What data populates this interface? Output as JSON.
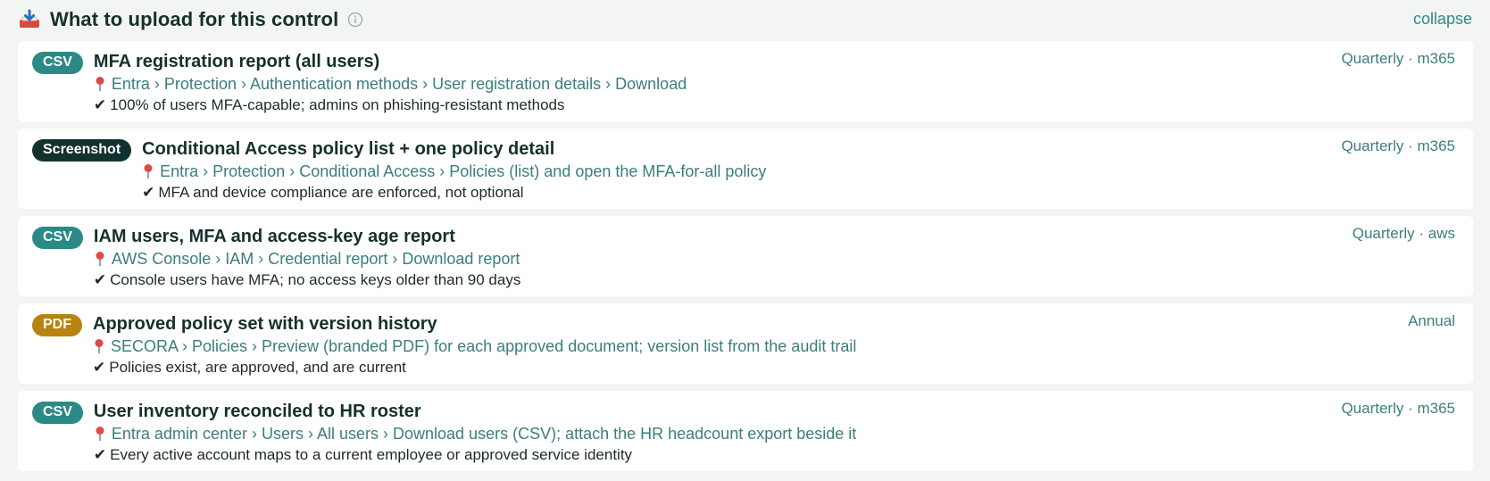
{
  "header": {
    "title": "What to upload for this control",
    "collapse_label": "collapse"
  },
  "items": [
    {
      "badge": "CSV",
      "badge_type": "csv",
      "title": "MFA registration report (all users)",
      "path": "Entra › Protection › Authentication methods › User registration details › Download",
      "check": "100% of users MFA-capable; admins on phishing-resistant methods",
      "meta": "Quarterly · m365"
    },
    {
      "badge": "Screenshot",
      "badge_type": "screenshot",
      "title": "Conditional Access policy list + one policy detail",
      "path": "Entra › Protection › Conditional Access › Policies (list) and open the MFA-for-all policy",
      "check": "MFA and device compliance are enforced, not optional",
      "meta": "Quarterly · m365"
    },
    {
      "badge": "CSV",
      "badge_type": "csv",
      "title": "IAM users, MFA and access-key age report",
      "path": "AWS Console › IAM › Credential report › Download report",
      "check": "Console users have MFA; no access keys older than 90 days",
      "meta": "Quarterly · aws"
    },
    {
      "badge": "PDF",
      "badge_type": "pdf",
      "title": "Approved policy set with version history",
      "path": "SECORA › Policies › Preview (branded PDF) for each approved document; version list from the audit trail",
      "check": "Policies exist, are approved, and are current",
      "meta": "Annual"
    },
    {
      "badge": "CSV",
      "badge_type": "csv",
      "title": "User inventory reconciled to HR roster",
      "path": "Entra admin center › Users › All users › Download users (CSV); attach the HR headcount export beside it",
      "check": "Every active account maps to a current employee or approved service identity",
      "meta": "Quarterly · m365"
    }
  ],
  "colors": {
    "csv_badge": "#2c8a86",
    "screenshot_badge": "#13322f",
    "pdf_badge": "#b8830f",
    "path_text": "#3a7f7a",
    "title_text": "#16302b",
    "link": "#2f8a84"
  },
  "icons": {
    "header": "inbox-tray-icon",
    "info": "info-icon",
    "pin": "pin-icon",
    "check": "check-icon"
  }
}
